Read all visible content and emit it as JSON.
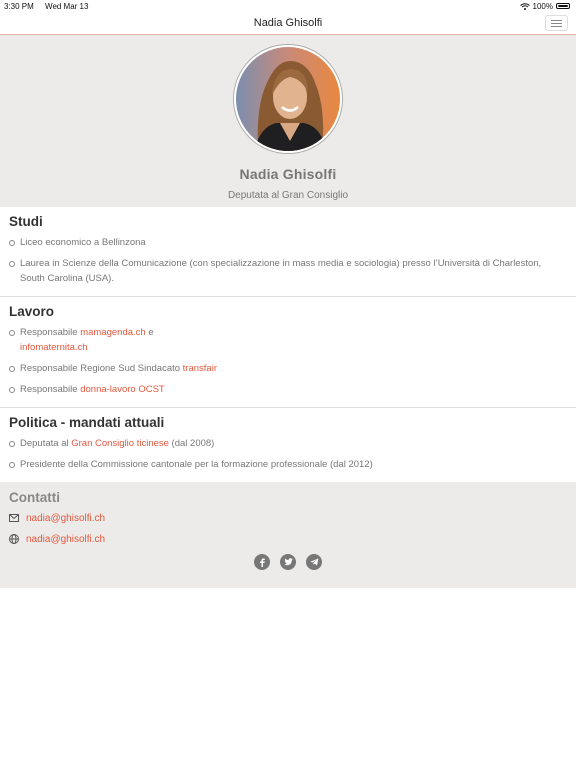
{
  "status": {
    "time": "3:30 PM",
    "date": "Wed Mar 13",
    "battery": "100%"
  },
  "nav": {
    "title": "Nadia Ghisolfi"
  },
  "profile": {
    "name": "Nadia Ghisolfi",
    "role": "Deputata al Gran Consiglio"
  },
  "studi": {
    "title": "Studi",
    "items": [
      "Liceo economico a Bellinzona",
      "Laurea in Scienze della Comunicazione (con specializzazione in mass media e sociologia) presso l’Università di Charleston, South Carolina (USA)."
    ]
  },
  "lavoro": {
    "title": "Lavoro",
    "item1": {
      "prefix": "Responsabile ",
      "link1": "mamagenda.ch",
      "mid": " e",
      "link2": "infomaternita.ch"
    },
    "item2": {
      "prefix": "Responsabile Regione Sud Sindacato ",
      "link": "transfair"
    },
    "item3": {
      "prefix": "Responsabile ",
      "link": "donna-lavoro OCST"
    }
  },
  "politica": {
    "title": "Politica - mandati attuali",
    "item1": {
      "prefix": "Deputata al ",
      "link": "Gran Consiglio ticinese",
      "suffix": " (dal 2008)"
    },
    "item2": "Presidente della Commissione cantonale per la formazione professionale (dal 2012)"
  },
  "contatti": {
    "title": "Contatti",
    "email": "nadia@ghisolfi.ch",
    "web": "nadia@ghisolfi.ch"
  },
  "icons": {
    "email": "envelope-icon",
    "web": "globe-icon",
    "social": [
      "facebook-icon",
      "twitter-icon",
      "telegram-icon"
    ]
  },
  "colors": {
    "accent": "#e2583e",
    "hero_bg": "#edebe9",
    "social": "#777777"
  }
}
